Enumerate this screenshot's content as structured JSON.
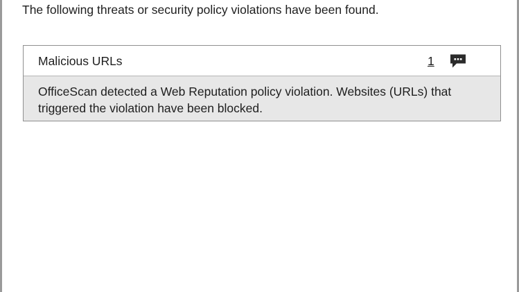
{
  "dialog": {
    "intro_text": "The following threats or security policy violations have been found."
  },
  "threats": [
    {
      "title": "Malicious URLs",
      "count": "1",
      "icon": "comment-icon",
      "description": "OfficeScan detected a Web Reputation policy violation. Websites (URLs) that triggered the violation have been blocked."
    }
  ],
  "colors": {
    "panel_border": "#8f8f8f",
    "description_background": "#e7e7e7",
    "icon": "#2b2b2b"
  }
}
